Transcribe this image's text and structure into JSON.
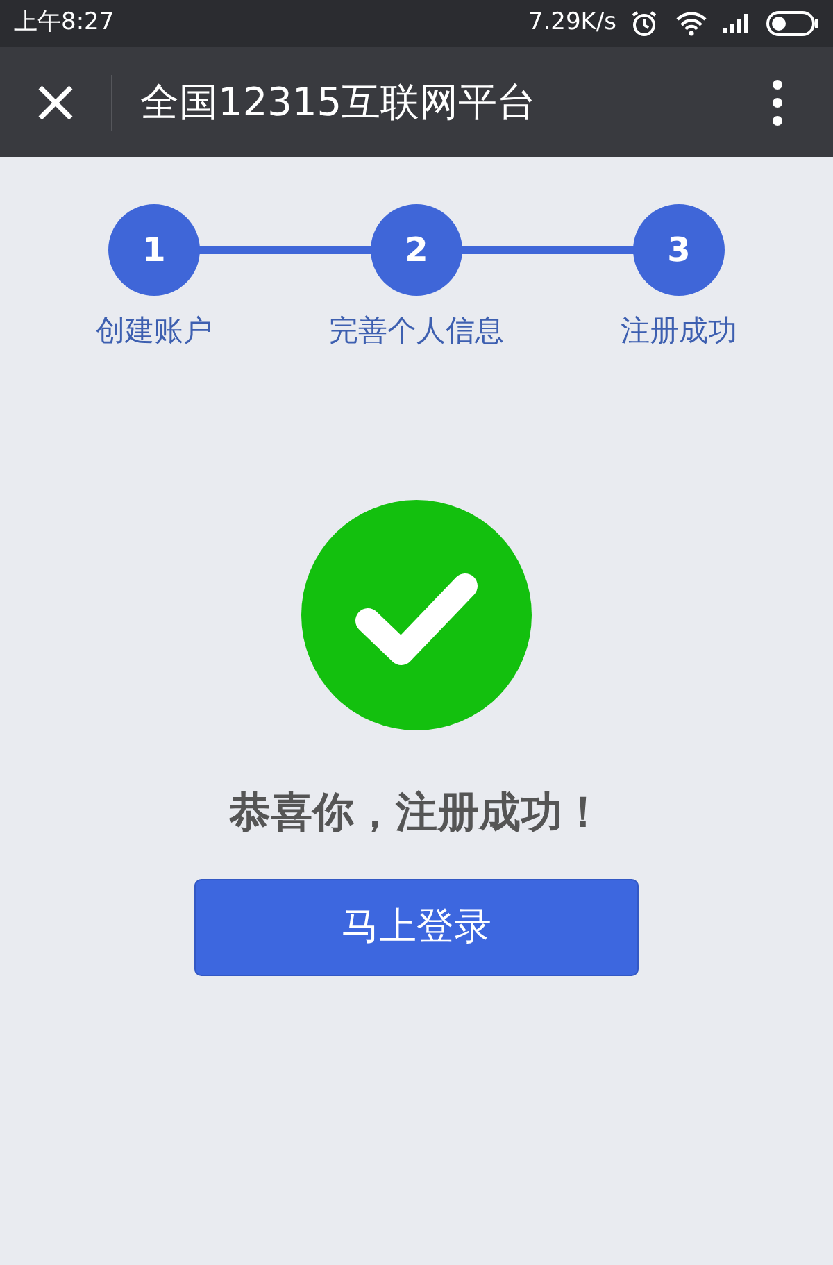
{
  "status_bar": {
    "time": "上午8:27",
    "speed": "7.29K/s"
  },
  "title_bar": {
    "title": "全国12315互联网平台"
  },
  "steps": [
    {
      "number": "1",
      "label": "创建账户",
      "done": true
    },
    {
      "number": "2",
      "label": "完善个人信息",
      "done": true
    },
    {
      "number": "3",
      "label": "注册成功",
      "done": true
    }
  ],
  "message": "恭喜你，注册成功！",
  "login_button": "马上登录"
}
